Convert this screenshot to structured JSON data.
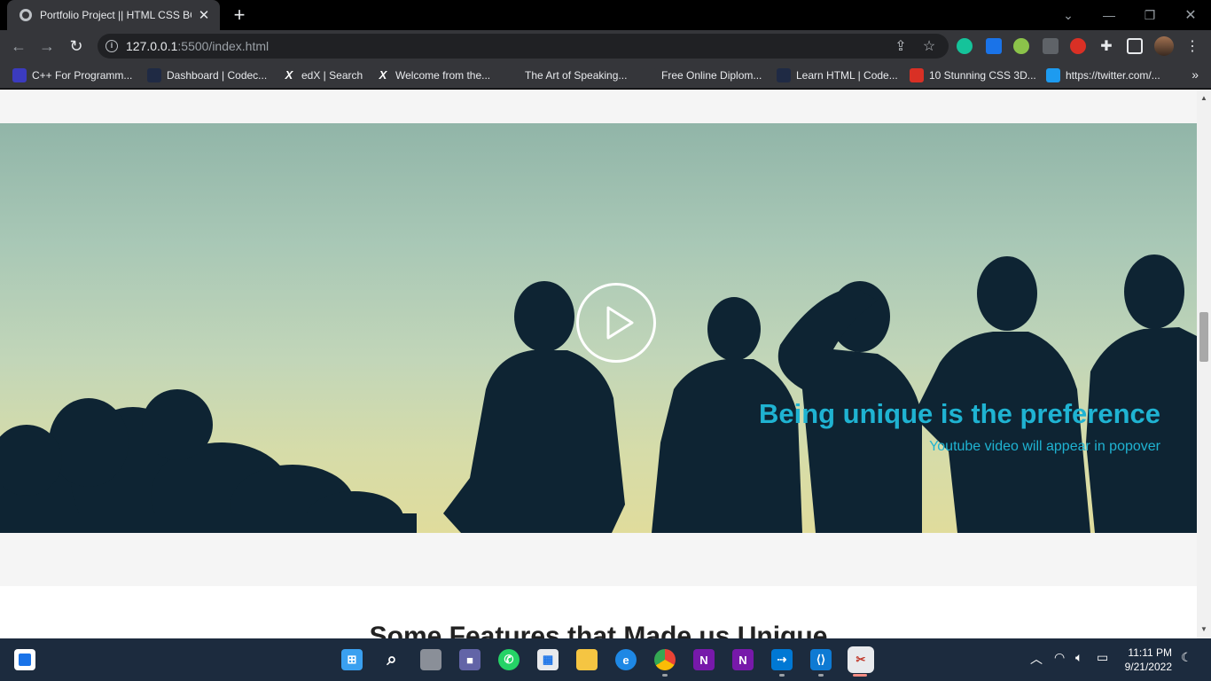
{
  "browser": {
    "tab_title": "Portfolio Project || HTML CSS BO",
    "new_tab_label": "+",
    "url_host": "127.0.0.1",
    "url_path": ":5500/index.html",
    "bookmarks": [
      {
        "label": "C++ For Programm...",
        "icon": "cpp-course-icon",
        "color": "#3b3bbf"
      },
      {
        "label": "Dashboard | Codec...",
        "icon": "codecademy-icon",
        "color": "#1f2a44"
      },
      {
        "label": "edX | Search",
        "icon": "edx-icon",
        "glyph": "X",
        "color": "#35363a"
      },
      {
        "label": "Welcome from the...",
        "icon": "edx-icon",
        "glyph": "X",
        "color": "#35363a"
      },
      {
        "label": "The Art of Speaking...",
        "icon": "alison-icon",
        "color": "#35363a"
      },
      {
        "label": "Free Online Diplom...",
        "icon": "alison-icon",
        "color": "#35363a"
      },
      {
        "label": "Learn HTML | Code...",
        "icon": "codecademy-icon",
        "color": "#1f2a44"
      },
      {
        "label": "10 Stunning CSS 3D...",
        "icon": "red-site-icon",
        "color": "#d93025"
      },
      {
        "label": "https://twitter.com/...",
        "icon": "twitter-icon",
        "color": "#1d9bf0"
      }
    ],
    "more_bookmarks": "»"
  },
  "page": {
    "hero_title": "Being unique is the preference",
    "hero_subtitle": "Youtube video will appear in popover",
    "features_title": "Some Features that Made us Unique"
  },
  "taskbar": {
    "time": "11:11 PM",
    "date": "9/21/2022"
  },
  "colors": {
    "accent": "#1fb3d2",
    "hero_sky_top": "#91b5a8",
    "hero_sky_bottom": "#e0dc9c",
    "silhouette": "#0e2433"
  }
}
